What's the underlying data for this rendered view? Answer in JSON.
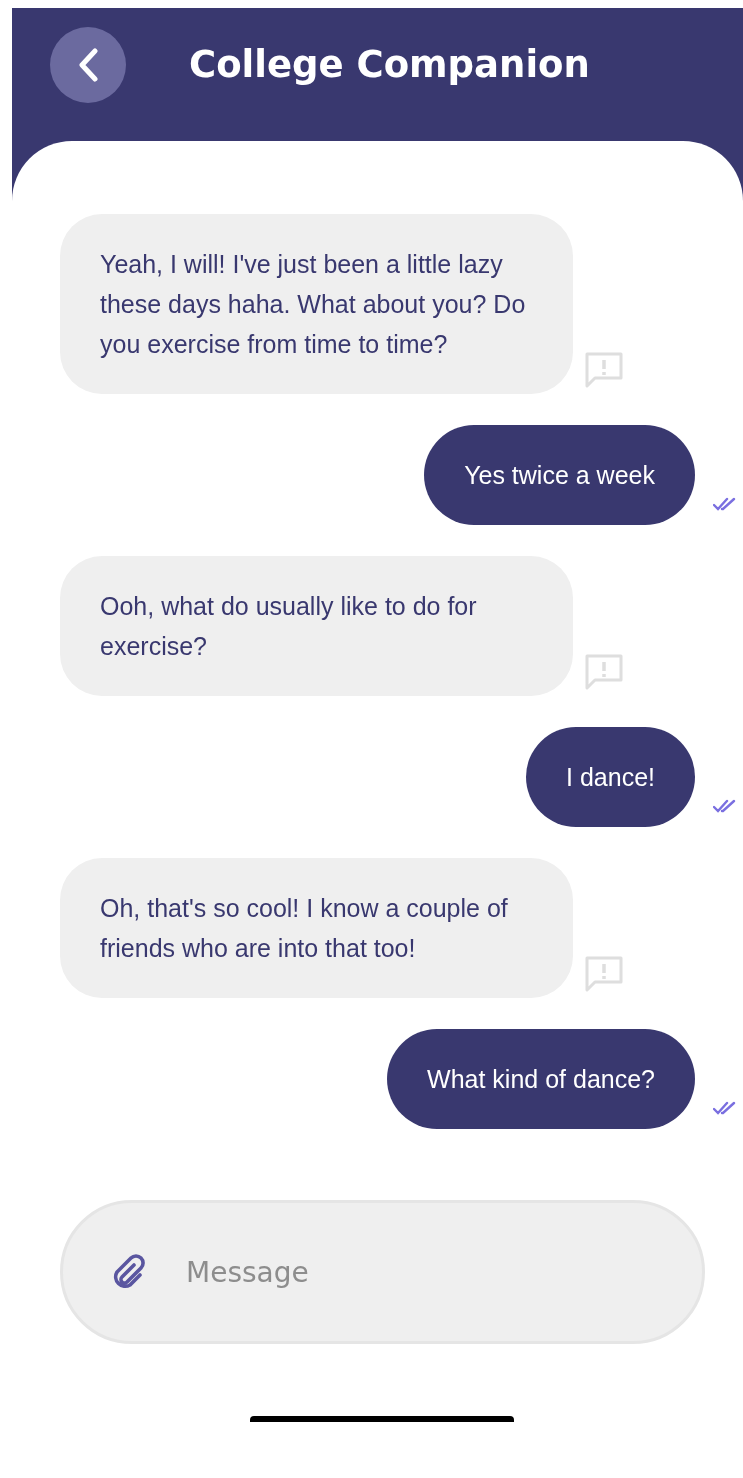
{
  "header": {
    "title": "College Companion"
  },
  "messages": [
    {
      "kind": "received",
      "text": "Yeah, I will! I've just been a little lazy these days haha. What about you? Do you exercise from time to time?"
    },
    {
      "kind": "sent",
      "text": "Yes twice a week",
      "read": true
    },
    {
      "kind": "received",
      "text": "Ooh, what do usually like to do for exercise?"
    },
    {
      "kind": "sent",
      "text": "I dance!",
      "read": true
    },
    {
      "kind": "received",
      "text": "Oh, that's so cool! I know a couple of friends who are into that too!"
    },
    {
      "kind": "sent",
      "text": "What kind of dance?",
      "read": true
    }
  ],
  "composer": {
    "placeholder": "Message"
  }
}
